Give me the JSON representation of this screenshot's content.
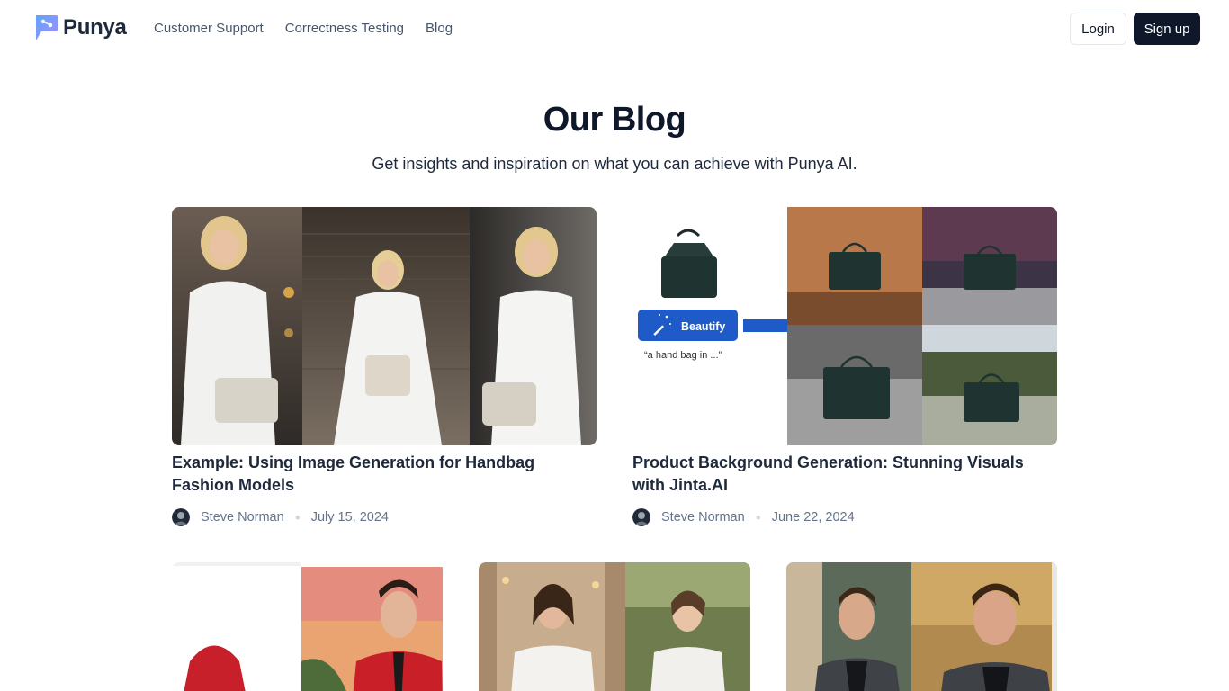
{
  "brand": {
    "name": "Punya",
    "accent": "#0f172a",
    "logo_gradient": [
      "#60a5fa",
      "#a78bfa"
    ]
  },
  "nav": {
    "items": [
      {
        "label": "Customer Support"
      },
      {
        "label": "Correctness Testing"
      },
      {
        "label": "Blog"
      }
    ],
    "login_label": "Login",
    "signup_label": "Sign up"
  },
  "hero": {
    "title": "Our Blog",
    "subtitle": "Get insights and inspiration on what you can achieve with Punya AI."
  },
  "posts": [
    {
      "title": "Example: Using Image Generation for Handbag Fashion Models",
      "author": "Steve Norman",
      "date": "July 15, 2024",
      "image": "three-models-white-outfits-handbag"
    },
    {
      "title": "Product Background Generation: Stunning Visuals with Jinta.AI",
      "author": "Steve Norman",
      "date": "June 22, 2024",
      "image": "handbag-beautify-backgrounds",
      "image_text": {
        "button": "Beautify",
        "caption": "“a hand bag in ...”"
      }
    },
    {
      "image": "red-jacket-model"
    },
    {
      "image": "women-white-dress"
    },
    {
      "image": "men-dark-blazer"
    }
  ]
}
